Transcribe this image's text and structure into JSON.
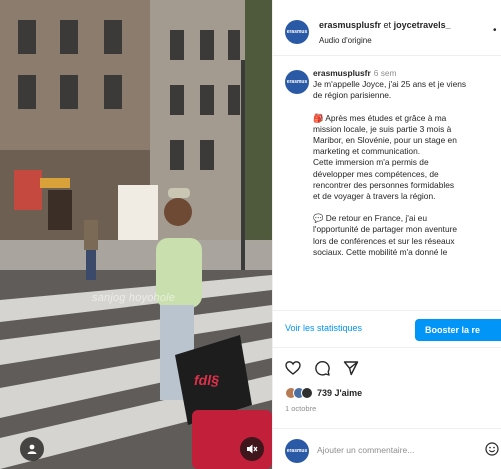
{
  "media": {
    "overlay_text": "sanjog hoyohole",
    "colors": {
      "street": "#5f5c5a",
      "building": "#8b7c6e",
      "jacket": "#c9dfae"
    }
  },
  "post": {
    "header": {
      "avatar_text": "erasmus",
      "account_1": "erasmusplusfr",
      "connector": "et",
      "account_2": "joycetravels_",
      "audio": "Audio d'origine",
      "more_icon": "more-icon"
    },
    "caption": {
      "avatar_text": "erasmus",
      "user": "erasmusplusfr",
      "age": "6 sem",
      "lines_1": [
        "Je m'appelle Joyce, j'ai 25 ans et je viens",
        "de région parisienne."
      ],
      "lines_2": [
        "🎒 Après mes études et grâce à ma",
        "mission locale, je suis partie 3 mois à",
        "Maribor, en Slovénie, pour un stage en",
        "marketing et communication.",
        "Cette immersion m'a permis de",
        "développer mes compétences, de",
        "rencontrer des personnes formidables",
        "et de voyager à travers la région."
      ],
      "lines_3": [
        "💬 De retour en France, j'ai eu",
        "l'opportunité de partager mon aventure",
        "lors de conférences et sur les réseaux",
        "sociaux. Cette mobilité m'a donné le"
      ]
    },
    "stats_link": "Voir les statistiques",
    "boost_button": "Booster la re",
    "likes": "739 J'aime",
    "date": "1 octobre",
    "comment_placeholder": "Ajouter un commentaire...",
    "accent_color": "#0095f6"
  }
}
